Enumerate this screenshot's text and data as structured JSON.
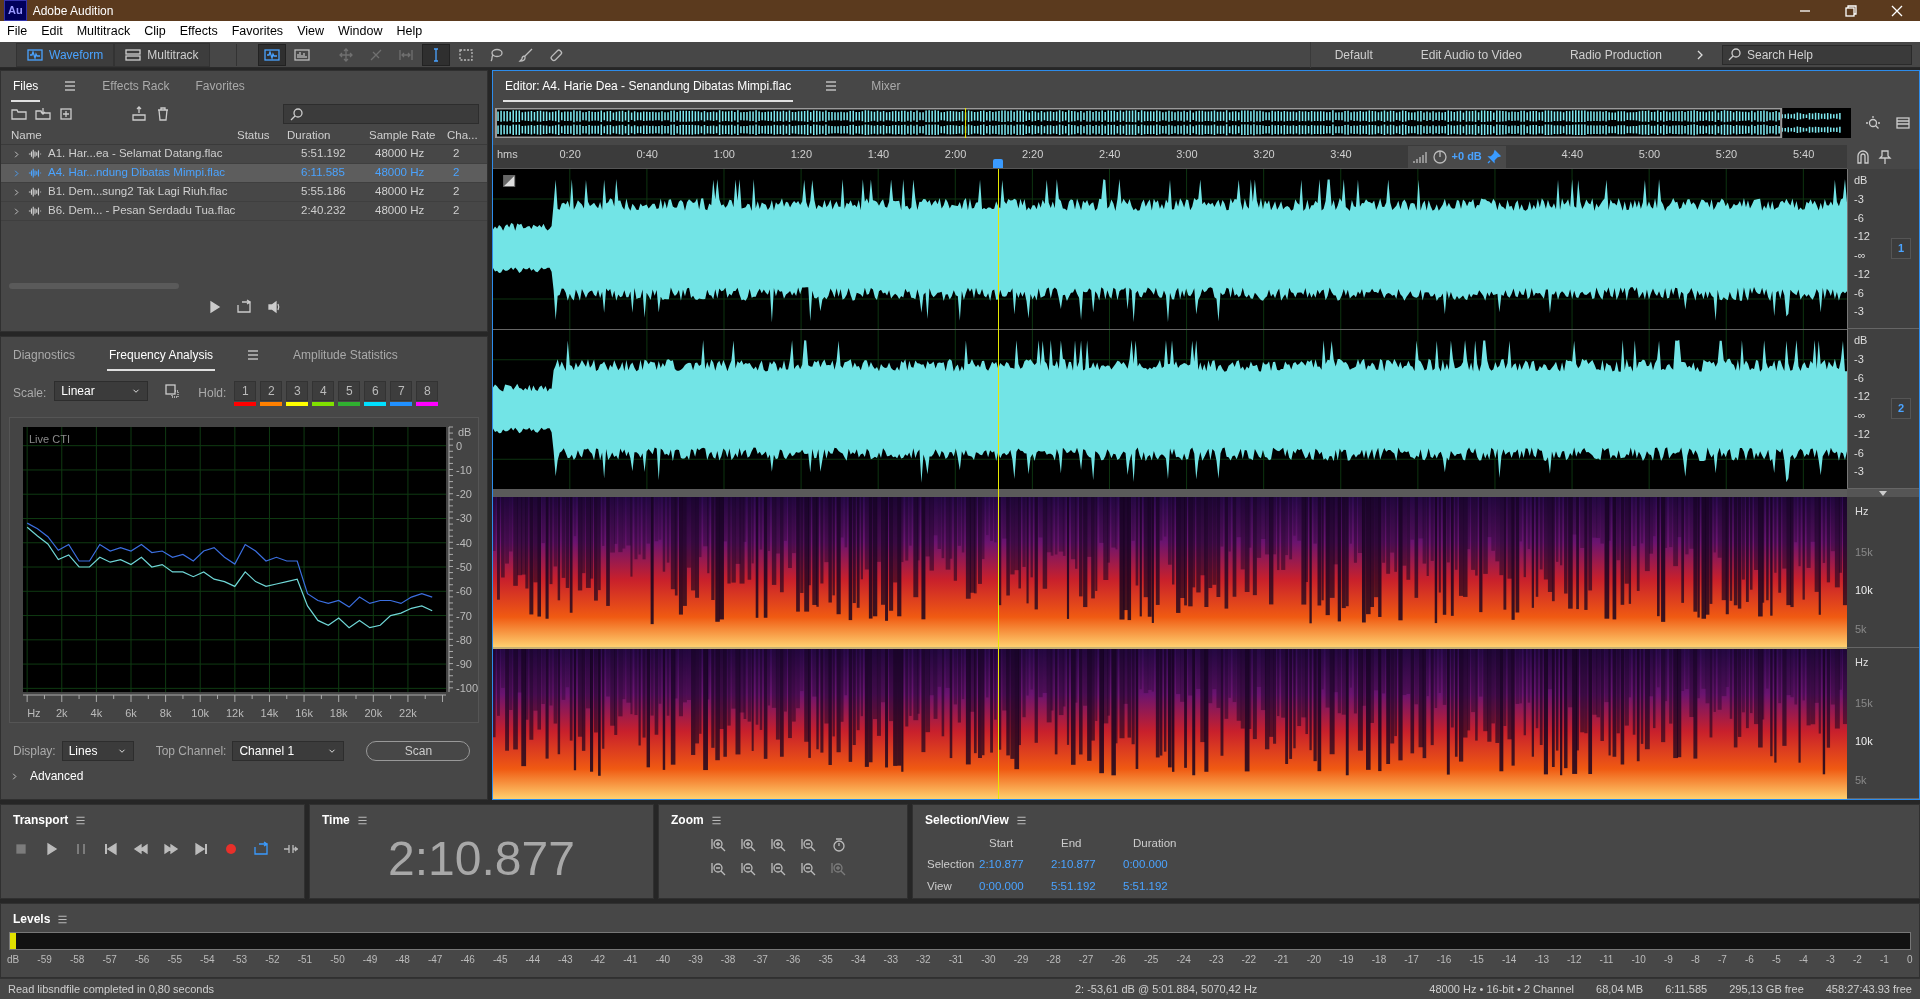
{
  "window": {
    "app_badge": "Au",
    "title": "Adobe Audition"
  },
  "menu": [
    "File",
    "Edit",
    "Multitrack",
    "Clip",
    "Effects",
    "Favorites",
    "View",
    "Window",
    "Help"
  ],
  "view_modes": [
    {
      "label": "Waveform",
      "kind": "wave",
      "selected": true
    },
    {
      "label": "Multitrack",
      "kind": "multi",
      "selected": false
    }
  ],
  "tools": [
    {
      "kind": "wave",
      "selected": true,
      "disabled": false
    },
    {
      "kind": "spec",
      "selected": false,
      "disabled": false
    },
    {
      "kind": "move",
      "selected": false,
      "disabled": true
    },
    {
      "kind": "razor",
      "selected": false,
      "disabled": true
    },
    {
      "kind": "slip",
      "selected": false,
      "disabled": true
    },
    {
      "kind": "ibeam",
      "selected": true,
      "disabled": false
    },
    {
      "kind": "marquee",
      "selected": false,
      "disabled": false
    },
    {
      "kind": "lasso",
      "selected": false,
      "disabled": false
    },
    {
      "kind": "brush",
      "selected": false,
      "disabled": false
    },
    {
      "kind": "heal",
      "selected": false,
      "disabled": false
    }
  ],
  "workspaces": [
    "Default",
    "Edit Audio to Video",
    "Radio Production"
  ],
  "search_help": {
    "placeholder": "Search Help"
  },
  "files_panel": {
    "tabs": [
      {
        "label": "Files",
        "selected": true
      },
      {
        "label": "Effects Rack",
        "selected": false
      },
      {
        "label": "Favorites",
        "selected": false
      }
    ],
    "columns": [
      "Name",
      "Status",
      "Duration",
      "Sample Rate",
      "Cha..."
    ],
    "rows": [
      {
        "name": "A1. Har...ea - Selamat Datang.flac",
        "duration": "5:51.192",
        "sample_rate": "48000 Hz",
        "channels": "2",
        "selected": false,
        "expanded": false
      },
      {
        "name": "A4. Har...ndung Dibatas Mimpi.flac",
        "duration": "6:11.585",
        "sample_rate": "48000 Hz",
        "channels": "2",
        "selected": true,
        "expanded": false
      },
      {
        "name": "B1. Dem...sung2 Tak Lagi Riuh.flac",
        "duration": "5:55.186",
        "sample_rate": "48000 Hz",
        "channels": "2",
        "selected": false,
        "expanded": false
      },
      {
        "name": "B6. Dem... - Pesan Serdadu Tua.flac",
        "duration": "2:40.232",
        "sample_rate": "48000 Hz",
        "channels": "2",
        "selected": false,
        "expanded": false
      }
    ]
  },
  "analysis_panel": {
    "tabs": [
      {
        "label": "Diagnostics",
        "selected": false
      },
      {
        "label": "Frequency Analysis",
        "selected": true
      },
      {
        "label": "Amplitude Statistics",
        "selected": false
      }
    ],
    "scale": {
      "label": "Scale:",
      "value": "Linear"
    },
    "hold": {
      "label": "Hold:",
      "buttons": [
        {
          "label": "1",
          "color": "#ff0000"
        },
        {
          "label": "2",
          "color": "#ff8000"
        },
        {
          "label": "3",
          "color": "#ffff00"
        },
        {
          "label": "4",
          "color": "#80e000"
        },
        {
          "label": "5",
          "color": "#30b030"
        },
        {
          "label": "6",
          "color": "#00e0ff"
        },
        {
          "label": "7",
          "color": "#2090ff"
        },
        {
          "label": "8",
          "color": "#ff00ff"
        }
      ]
    },
    "chart_caption": "Live CTI",
    "chart_data": {
      "type": "line",
      "ylabel": "dB",
      "grid": true,
      "xlim": [
        -240,
        24200
      ],
      "ylim": [
        -101.5,
        7.7
      ],
      "x": [
        0,
        600,
        1200,
        1800,
        2400,
        3000,
        3600,
        4200,
        4800,
        5400,
        6000,
        6600,
        7200,
        7800,
        8400,
        9000,
        9600,
        10200,
        10800,
        11400,
        12000,
        12600,
        13200,
        13800,
        14400,
        15000,
        15600,
        16200,
        16800,
        17400,
        18000,
        18600,
        19200,
        19800,
        20400,
        21000,
        21600,
        22200,
        22800,
        23400
      ],
      "series": [
        {
          "color": "#3b6fe0",
          "values": [
            -31.9,
            -34.2,
            -37.5,
            -43.1,
            -40.7,
            -47.5,
            -47.5,
            -40.7,
            -43.4,
            -42,
            -43.4,
            -40.7,
            -44,
            -43.4,
            -46,
            -44.8,
            -47.5,
            -43.4,
            -42,
            -46,
            -48.8,
            -40.7,
            -43.4,
            -47.5,
            -46,
            -47.5,
            -47.5,
            -61,
            -63.8,
            -65,
            -63.8,
            -66.5,
            -62.4,
            -65,
            -63.8,
            -63.8,
            -65,
            -62.4,
            -61,
            -62.4
          ]
        },
        {
          "color": "#6fd6d6",
          "values": [
            -33.6,
            -37.2,
            -40.5,
            -46.9,
            -45,
            -50,
            -50,
            -46,
            -48,
            -47,
            -49,
            -46,
            -50,
            -49,
            -52,
            -52,
            -54,
            -52,
            -55,
            -56,
            -58,
            -52,
            -56,
            -58,
            -57,
            -56,
            -55,
            -66,
            -72,
            -74,
            -71,
            -75,
            -72,
            -75,
            -74,
            -70,
            -69,
            -67,
            -66,
            -68
          ]
        }
      ],
      "xticks": [
        {
          "value": 0,
          "label": "Hz"
        },
        {
          "value": 2000,
          "label": "2k"
        },
        {
          "value": 4000,
          "label": "4k"
        },
        {
          "value": 6000,
          "label": "6k"
        },
        {
          "value": 8000,
          "label": "8k"
        },
        {
          "value": 10000,
          "label": "10k"
        },
        {
          "value": 12000,
          "label": "12k"
        },
        {
          "value": 14000,
          "label": "14k"
        },
        {
          "value": 16000,
          "label": "16k"
        },
        {
          "value": 18000,
          "label": "18k"
        },
        {
          "value": 20000,
          "label": "20k"
        },
        {
          "value": 22000,
          "label": "22k"
        }
      ],
      "yticks": [
        0,
        -10,
        -20,
        -30,
        -40,
        -50,
        -60,
        -70,
        -80,
        -90,
        -100
      ]
    },
    "display": {
      "label": "Display:",
      "value": "Lines"
    },
    "top_channel": {
      "label": "Top Channel:",
      "value": "Channel 1"
    },
    "scan_button": "Scan",
    "advanced": {
      "label": "Advanced",
      "expanded": false
    }
  },
  "editor": {
    "tabs": [
      {
        "label": "Editor: A4. Harie Dea - Senandung Dibatas Mimpi.flac",
        "selected": true
      },
      {
        "label": "Mixer",
        "selected": false
      }
    ],
    "ruler": [
      {
        "kind": "unit",
        "text": "hms"
      },
      {
        "kind": "time",
        "text": "0:20"
      },
      {
        "kind": "time",
        "text": "0:40"
      },
      {
        "kind": "time",
        "text": "1:00"
      },
      {
        "kind": "time",
        "text": "1:20"
      },
      {
        "kind": "time",
        "text": "1:40"
      },
      {
        "kind": "time",
        "text": "2:00"
      },
      {
        "kind": "time",
        "text": "2:20"
      },
      {
        "kind": "time",
        "text": "2:40"
      },
      {
        "kind": "time",
        "text": "3:00"
      },
      {
        "kind": "time",
        "text": "3:20"
      },
      {
        "kind": "time",
        "text": "3:40"
      },
      {
        "kind": "hud",
        "text": "+0 dB"
      },
      {
        "kind": "time",
        "text": "4:40"
      },
      {
        "kind": "time",
        "text": "5:00"
      },
      {
        "kind": "time",
        "text": "5:20"
      },
      {
        "kind": "time",
        "text": "5:40"
      }
    ],
    "playhead": {
      "level": 0.3727
    },
    "channels": [
      {
        "number": "1",
        "scale": [
          "dB",
          "-3",
          "-6",
          "-12",
          "-∞",
          "-12",
          "-6",
          "-3"
        ]
      },
      {
        "number": "2",
        "scale": [
          "dB",
          "-3",
          "-6",
          "-12",
          "-∞",
          "-12",
          "-6",
          "-3"
        ]
      }
    ],
    "spectral": [
      {
        "unit": "Hz",
        "labels": [
          "15k",
          "10k",
          "5k"
        ]
      },
      {
        "unit": "Hz",
        "labels": [
          "15k",
          "10k",
          "5k"
        ]
      }
    ]
  },
  "transport": {
    "title": "Transport",
    "buttons": [
      {
        "kind": "stop",
        "on": false,
        "disabled": true
      },
      {
        "kind": "play",
        "on": false,
        "disabled": false
      },
      {
        "kind": "pause",
        "on": false,
        "disabled": true
      },
      {
        "kind": "tostart",
        "on": false,
        "disabled": false
      },
      {
        "kind": "rewind",
        "on": false,
        "disabled": false
      },
      {
        "kind": "forward",
        "on": false,
        "disabled": false
      },
      {
        "kind": "toend",
        "on": false,
        "disabled": false
      },
      {
        "kind": "record",
        "on": false,
        "disabled": false
      },
      {
        "kind": "loop",
        "on": true,
        "disabled": false
      },
      {
        "kind": "skip",
        "on": false,
        "disabled": false
      }
    ]
  },
  "time": {
    "title": "Time",
    "value": "2:10.877"
  },
  "zoom": {
    "title": "Zoom",
    "buttons": [
      {
        "kind": "in",
        "disabled": false
      },
      {
        "kind": "in",
        "disabled": false
      },
      {
        "kind": "in",
        "disabled": false
      },
      {
        "kind": "out",
        "disabled": false
      },
      {
        "kind": "reset",
        "disabled": false
      },
      {
        "kind": "out",
        "disabled": false
      },
      {
        "kind": "out",
        "disabled": false
      },
      {
        "kind": "out",
        "disabled": false
      },
      {
        "kind": "out",
        "disabled": false
      },
      {
        "kind": "in",
        "disabled": true
      }
    ]
  },
  "selection_view": {
    "title": "Selection/View",
    "headers": [
      "Start",
      "End",
      "Duration"
    ],
    "rows": [
      {
        "label": "Selection",
        "values": [
          "2:10.877",
          "2:10.877",
          "0:00.000"
        ]
      },
      {
        "label": "View",
        "values": [
          "0:00.000",
          "5:51.192",
          "5:51.192"
        ]
      }
    ]
  },
  "levels": {
    "title": "Levels",
    "level": 0.003,
    "scale": [
      "dB",
      "-59",
      "-58",
      "-57",
      "-56",
      "-55",
      "-54",
      "-53",
      "-52",
      "-51",
      "-50",
      "-49",
      "-48",
      "-47",
      "-46",
      "-45",
      "-44",
      "-43",
      "-42",
      "-41",
      "-40",
      "-39",
      "-38",
      "-37",
      "-36",
      "-35",
      "-34",
      "-33",
      "-32",
      "-31",
      "-30",
      "-29",
      "-28",
      "-27",
      "-26",
      "-25",
      "-24",
      "-23",
      "-22",
      "-21",
      "-20",
      "-19",
      "-18",
      "-17",
      "-16",
      "-15",
      "-14",
      "-13",
      "-12",
      "-11",
      "-10",
      "-9",
      "-8",
      "-7",
      "-6",
      "-5",
      "-4",
      "-3",
      "-2",
      "-1",
      "0"
    ]
  },
  "status_bar": {
    "message": "Read libsndfile completed in 0,80 seconds",
    "items": [
      "2: -53,61 dB @ 5:01.884, 5070,42 Hz",
      "48000 Hz • 16-bit • 2 Channel",
      "68,04 MB",
      "6:11.585",
      "295,13 GB free",
      "458:27:43.93 free"
    ]
  }
}
